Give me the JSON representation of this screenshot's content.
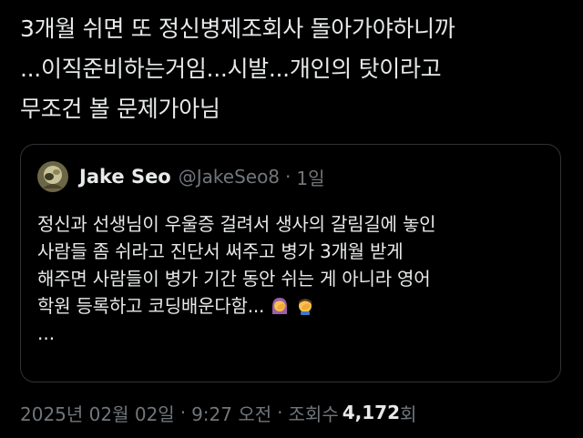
{
  "tweet": {
    "lines": [
      "3개월 쉬면 또 정신병제조회사 돌아가야하니까",
      "...이직준비하는거임...시발...개인의 탓이라고",
      "무조건 볼 문제가아님"
    ]
  },
  "quote": {
    "author_name": "Jake Seo",
    "author_handle": "@JakeSeo8",
    "separator": "·",
    "age": "1일",
    "lines": [
      "정신과 선생님이 우울증 걸려서 생사의 갈림길에 놓인",
      "사람들 좀 쉬라고 진단서 써주고 병가 3개월 받게",
      "해주면 사람들이 병가 기간 동안 쉬는 게 아니라 영어",
      "학원 등록하고 코딩배운다함..."
    ],
    "truncation": "...",
    "emoji_1": "woman-facepalming-emoji",
    "emoji_2": "man-facepalming-emoji"
  },
  "meta": {
    "date": "2025년 02월 02일",
    "separator": "·",
    "time": "9:27 오전",
    "views_label": "조회수",
    "views_count": "4,172",
    "views_unit": "회"
  },
  "colors": {
    "background": "#000000",
    "text_primary": "#e7e9ea",
    "text_secondary": "#71767b",
    "card_border": "#2f3336"
  }
}
